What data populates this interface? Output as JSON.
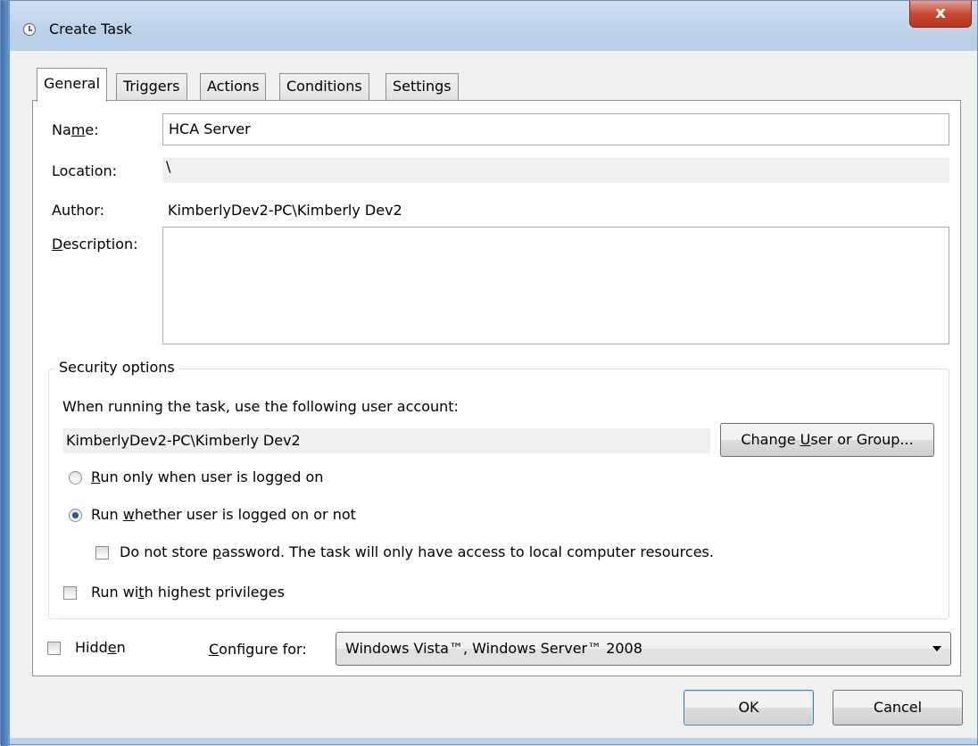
{
  "window": {
    "title": "Create Task",
    "close_glyph": "x"
  },
  "tabs": [
    {
      "label": "General",
      "active": true
    },
    {
      "label": "Triggers",
      "active": false
    },
    {
      "label": "Actions",
      "active": false
    },
    {
      "label": "Conditions",
      "active": false
    },
    {
      "label": "Settings",
      "active": false
    }
  ],
  "general": {
    "name_label_pre": "Na",
    "name_label_u": "m",
    "name_label_post": "e:",
    "name_value": "HCA Server",
    "location_label": "Location:",
    "location_value": "\\",
    "author_label": "Author:",
    "author_value": "KimberlyDev2-PC\\Kimberly Dev2",
    "description_label_u": "D",
    "description_label_post": "escription:",
    "description_value": ""
  },
  "security": {
    "legend": "Security options",
    "account_prompt": "When running the task, use the following user account:",
    "account_value": "KimberlyDev2-PC\\Kimberly Dev2",
    "change_button_pre": "Change ",
    "change_button_u": "U",
    "change_button_post": "ser or Group...",
    "radio_logged_on_u": "R",
    "radio_logged_on_post": "un only when user is logged on",
    "radio_logged_on_checked": false,
    "radio_whether_pre": "Run ",
    "radio_whether_u": "w",
    "radio_whether_post": "hether user is logged on or not",
    "radio_whether_checked": true,
    "no_password_pre": "Do not store ",
    "no_password_u": "p",
    "no_password_post": "assword.  The task will only have access to local computer resources.",
    "no_password_checked": false,
    "highest_pre": "Run wi",
    "highest_u": "t",
    "highest_post": "h highest privileges",
    "highest_checked": false
  },
  "footer_options": {
    "hidden_pre": "Hidd",
    "hidden_u": "e",
    "hidden_post": "n",
    "hidden_checked": false,
    "configure_u": "C",
    "configure_post": "onfigure for:",
    "configure_value": "Windows Vista™, Windows Server™ 2008"
  },
  "buttons": {
    "ok": "OK",
    "cancel": "Cancel"
  },
  "icons": [
    "clock-icon",
    "close-icon",
    "dropdown-arrow-icon"
  ]
}
